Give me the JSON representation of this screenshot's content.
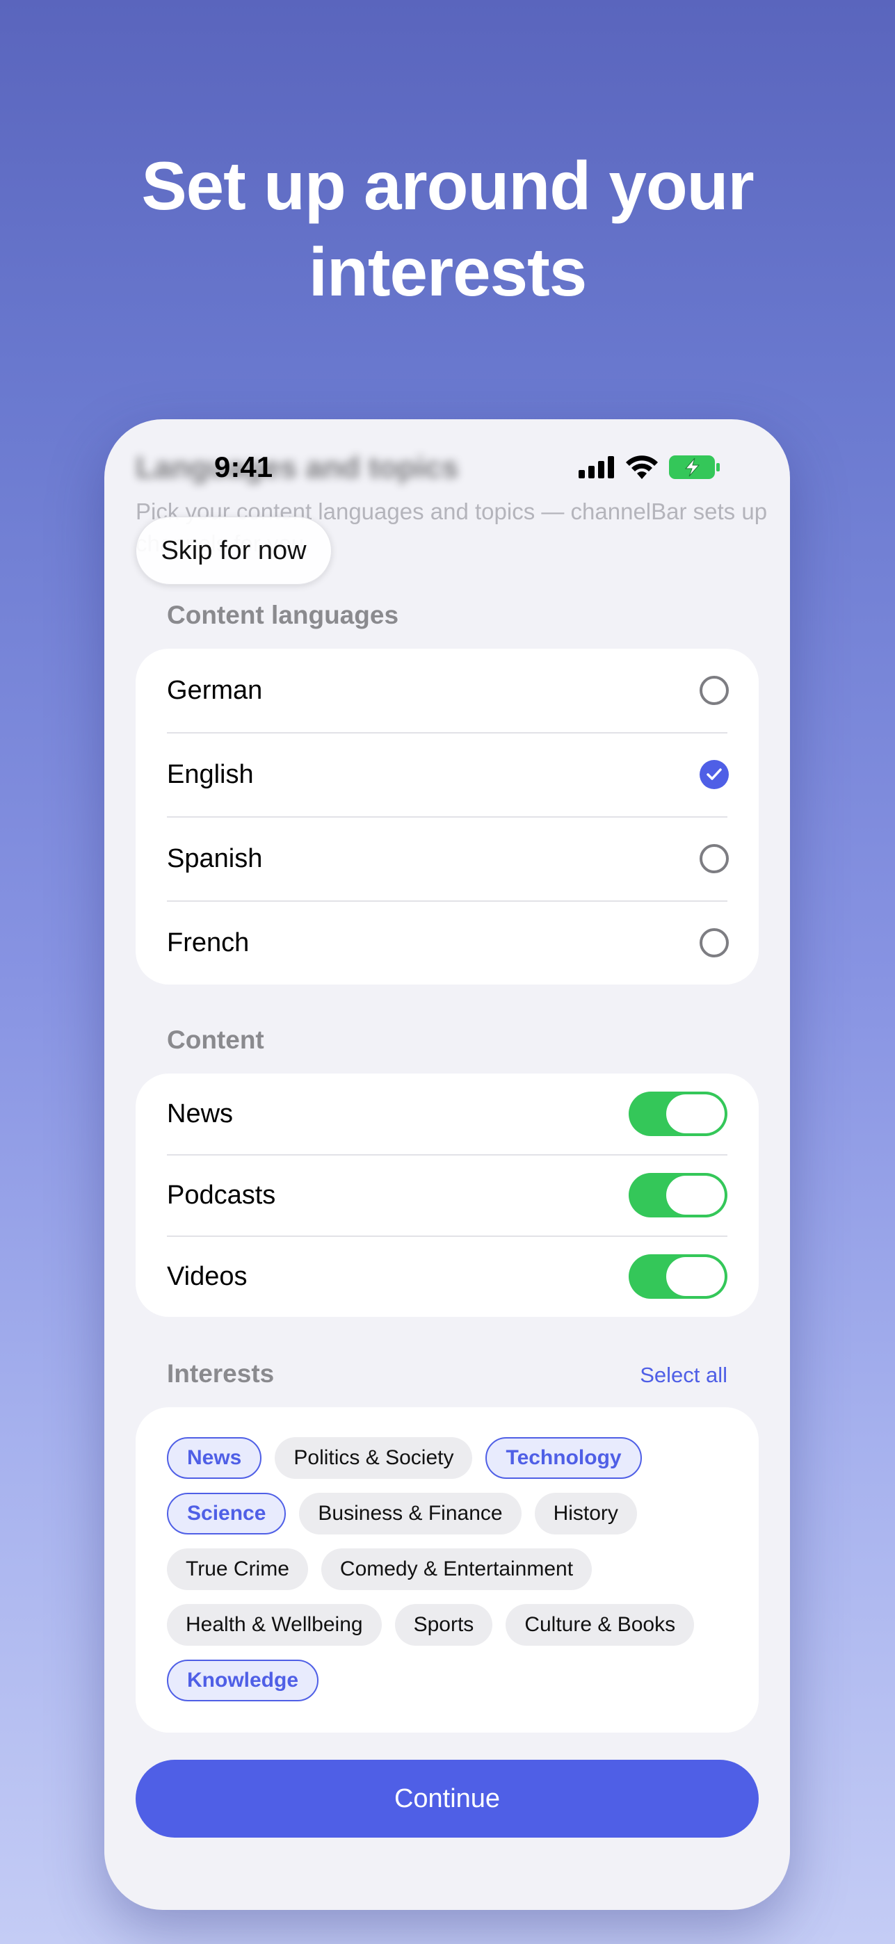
{
  "headline": {
    "line1": "Set up around your",
    "line2": "interests"
  },
  "status_bar": {
    "time": "9:41"
  },
  "background_screen": {
    "title": "Languages and topics",
    "subtitle": "Pick your content languages and topics — channelBar sets up channels for you."
  },
  "skip_label": "Skip for now",
  "languages": {
    "header": "Content languages",
    "items": [
      {
        "label": "German",
        "selected": false
      },
      {
        "label": "English",
        "selected": true
      },
      {
        "label": "Spanish",
        "selected": false
      },
      {
        "label": "French",
        "selected": false
      }
    ]
  },
  "content": {
    "header": "Content",
    "items": [
      {
        "label": "News",
        "on": true
      },
      {
        "label": "Podcasts",
        "on": true
      },
      {
        "label": "Videos",
        "on": true
      }
    ]
  },
  "interests": {
    "header": "Interests",
    "select_all": "Select all",
    "chips": [
      {
        "label": "News",
        "selected": true
      },
      {
        "label": "Politics & Society",
        "selected": false
      },
      {
        "label": "Technology",
        "selected": true
      },
      {
        "label": "Science",
        "selected": true
      },
      {
        "label": "Business & Finance",
        "selected": false
      },
      {
        "label": "History",
        "selected": false
      },
      {
        "label": "True Crime",
        "selected": false
      },
      {
        "label": "Comedy & Entertainment",
        "selected": false
      },
      {
        "label": "Health & Wellbeing",
        "selected": false
      },
      {
        "label": "Sports",
        "selected": false
      },
      {
        "label": "Culture & Books",
        "selected": false
      },
      {
        "label": "Knowledge",
        "selected": true
      }
    ]
  },
  "continue_label": "Continue",
  "colors": {
    "accent": "#4f5fe6",
    "toggle_on": "#34c759",
    "battery": "#34c759"
  },
  "icons": [
    "cellular-signal-icon",
    "wifi-icon",
    "battery-charging-icon",
    "checkmark-icon"
  ]
}
